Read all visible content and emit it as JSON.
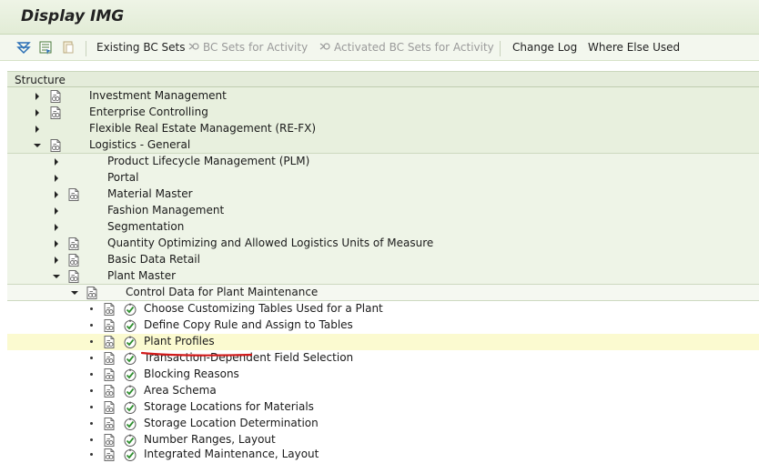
{
  "title": "Display IMG",
  "toolbar": {
    "existing_bc_sets": "Existing BC Sets",
    "bc_sets_for_activity": "BC Sets for Activity",
    "activated_bc_sets": "Activated BC Sets for Activity",
    "change_log": "Change Log",
    "where_else_used": "Where Else Used"
  },
  "structure_header": "Structure",
  "tree": {
    "investment_management": "Investment Management",
    "enterprise_controlling": "Enterprise Controlling",
    "flexible_real_estate": "Flexible Real Estate Management (RE-FX)",
    "logistics_general": "Logistics - General",
    "plm": "Product Lifecycle Management (PLM)",
    "portal": "Portal",
    "material_master": "Material Master",
    "fashion_management": "Fashion Management",
    "segmentation": "Segmentation",
    "quantity_optimizing": "Quantity Optimizing and Allowed Logistics Units of Measure",
    "basic_data_retail": "Basic Data Retail",
    "plant_master": "Plant Master",
    "control_data": "Control Data for Plant Maintenance",
    "choose_customizing": "Choose Customizing Tables Used for a Plant",
    "define_copy_rule": "Define Copy Rule and Assign to Tables",
    "plant_profiles": "Plant Profiles",
    "transaction_dependent": "Transaction-Dependent Field Selection",
    "blocking_reasons": "Blocking Reasons",
    "area_schema": "Area Schema",
    "storage_locations": "Storage Locations for Materials",
    "storage_location_determination": "Storage Location Determination",
    "number_ranges": "Number Ranges, Layout",
    "integrated_maintenance": "Integrated Maintenance, Layout"
  },
  "colors": {
    "header_bg": "#e2ecd6",
    "highlight_row": "#fbfad0",
    "underline_red": "#d21a1a",
    "exec_green": "#2f8f2f"
  }
}
